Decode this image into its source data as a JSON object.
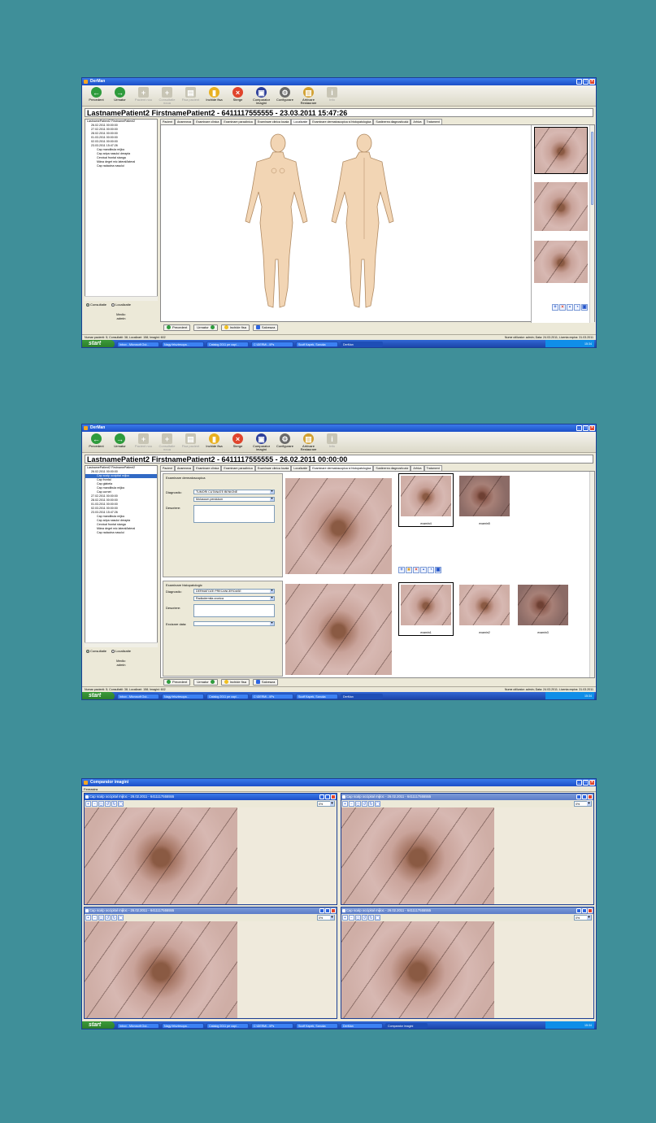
{
  "colors": {
    "background": "#3f8f99",
    "titlebar": "#1c4fc8",
    "accent_green": "#2e9b3c",
    "close_red": "#e0442c"
  },
  "app_title": "DerMan",
  "toolbar": [
    {
      "label": "Precedent",
      "icon": "back-arrow-icon",
      "enabled": true
    },
    {
      "label": "Urmator",
      "icon": "forward-arrow-icon",
      "enabled": true
    },
    {
      "label": "Pacient nou",
      "icon": "new-patient-icon",
      "enabled": false
    },
    {
      "label": "Consultatie noua",
      "icon": "new-consult-icon",
      "enabled": false
    },
    {
      "label": "Fisa pacient",
      "icon": "patient-file-icon",
      "enabled": false
    },
    {
      "label": "Inchide fisa",
      "icon": "close-file-icon",
      "enabled": true
    },
    {
      "label": "Sterge",
      "icon": "delete-icon",
      "enabled": true
    },
    {
      "label": "Comparator imagini",
      "icon": "image-compare-icon",
      "enabled": true
    },
    {
      "label": "Configurare",
      "icon": "settings-icon",
      "enabled": true
    },
    {
      "label": "Arhivare Restaurare",
      "icon": "archive-icon",
      "enabled": true
    },
    {
      "label": "Info",
      "icon": "info-icon",
      "enabled": false
    }
  ],
  "tabs": [
    "Pacient",
    "Anamneza",
    "Examinare clinica",
    "Examinare paraclinica",
    "Examinare clinica locala",
    "Localizatie",
    "Examinare dermatoscopica si histopatologica",
    "Sustinerea diagnosticului",
    "Arhiva",
    "Tratament"
  ],
  "radios": {
    "consultatie": "Consultatie",
    "localizatie": "Localizatie"
  },
  "medic": {
    "label": "Medic:",
    "name": "admin"
  },
  "nav": {
    "prev": "Precedent",
    "next": "Urmator",
    "close": "Inchide fisa",
    "save": "Salveaza"
  },
  "statusbar": {
    "left": "Numar pacienti: 5; Consultatii: 38; Localizari: 158; Imagini: 602",
    "right": "Nume utilizator: admin; Data: 24.03.2011; Licenta expira: 31.03.2011"
  },
  "taskbar": {
    "start": "start",
    "items": [
      "Inbox - Microsoft Out...",
      "Nagy felsztesopa...",
      "Catalog 2011 pe capi...",
      "C:\\DERM\\...\\IPs",
      "Scoff Kapek, Sanuka",
      "DerMan"
    ],
    "items3": [
      "Inbox - Microsoft Out...",
      "Nagy felsztesopa...",
      "Catalog 2011 pe capi...",
      "C:\\DERM\\...\\IPs",
      "Scoff Kapek, Sanuka",
      "DerMan",
      "Comparator imagini"
    ],
    "clock": "15:34"
  },
  "shot1": {
    "header": "LastnamePatient2  FirstnamePatient2  -  6411117555555  -  23.03.2011  15:47:26",
    "tree": [
      {
        "t": "LastnamePatient2 FirstnamePatient2",
        "l": 0
      },
      {
        "t": "26.02.2011 00:00:00",
        "l": 1
      },
      {
        "t": "27.02.2011 00:00:00",
        "l": 1
      },
      {
        "t": "28.02.2011 00:00:00",
        "l": 1
      },
      {
        "t": "01.03.2011 00:00:00",
        "l": 1
      },
      {
        "t": "02.03.2011 00:00:00",
        "l": 1
      },
      {
        "t": "23.03.2011 15:47:26",
        "l": 1
      },
      {
        "t": "Cap mandibula mijloc",
        "l": 2
      },
      {
        "t": "Cap aripa nasului dreapta",
        "l": 2
      },
      {
        "t": "Cervical frontal stanga",
        "l": 2
      },
      {
        "t": "Mâna deget mic lateral/lateral",
        "l": 2
      },
      {
        "t": "Cap radacina nasului",
        "l": 2
      }
    ]
  },
  "shot2": {
    "header": "LastnamePatient2  FirstnamePatient2  -  6411117555555  -  26.02.2011  00:00:00",
    "tree": [
      {
        "t": "LastnamePatient2 FirstnamePatient2",
        "l": 0
      },
      {
        "t": "26.02.2011 00:00:00",
        "l": 1
      },
      {
        "t": "Cap scalp occipital mijloc",
        "l": 2,
        "sel": true
      },
      {
        "t": "Cap frontal",
        "l": 2
      },
      {
        "t": "Cap glabela",
        "l": 2
      },
      {
        "t": "Cap mandibula mijloc",
        "l": 2
      },
      {
        "t": "Cap cornet",
        "l": 2
      },
      {
        "t": "27.02.2011 00:00:00",
        "l": 1
      },
      {
        "t": "28.02.2011 00:00:00",
        "l": 1
      },
      {
        "t": "01.03.2011 00:00:00",
        "l": 1
      },
      {
        "t": "02.03.2011 00:00:00",
        "l": 1
      },
      {
        "t": "23.03.2011 15:47:26",
        "l": 1
      },
      {
        "t": "Cap mandibula mijloc",
        "l": 2
      },
      {
        "t": "Cap aripa nasului dreapta",
        "l": 2
      },
      {
        "t": "Cervical frontal stanga",
        "l": 2
      },
      {
        "t": "Mâna deget mic lateral/lateral",
        "l": 2
      },
      {
        "t": "Cap radacina nasului",
        "l": 2
      }
    ],
    "dermato": {
      "title": "Examinare dermatoscopica",
      "diag_label": "Diagnostic:",
      "diag_value": "TUMORI CUTANATE BENIGNE",
      "sub_value": "Moluscum pendulum",
      "desc_label": "Descriere:",
      "thumbs": [
        "examin4",
        "examin5"
      ]
    },
    "histo": {
      "title": "Examinare histopatologic",
      "diag_label": "Diagnostic:",
      "diag_value": "DERMATOZE PRECANCEROASE",
      "sub_value": "Radiodermita cronica",
      "desc_label": "Descriere:",
      "excision_label": "Excizare data:",
      "thumbs": [
        "examin1",
        "examin2",
        "examin3"
      ]
    }
  },
  "shot3": {
    "title": "Comparator imagini",
    "menu": "Fereastra",
    "panel_title": "Cap scalp occipital mijloc - 26.02.2011 - 6411117555555",
    "zoom": "0%"
  }
}
